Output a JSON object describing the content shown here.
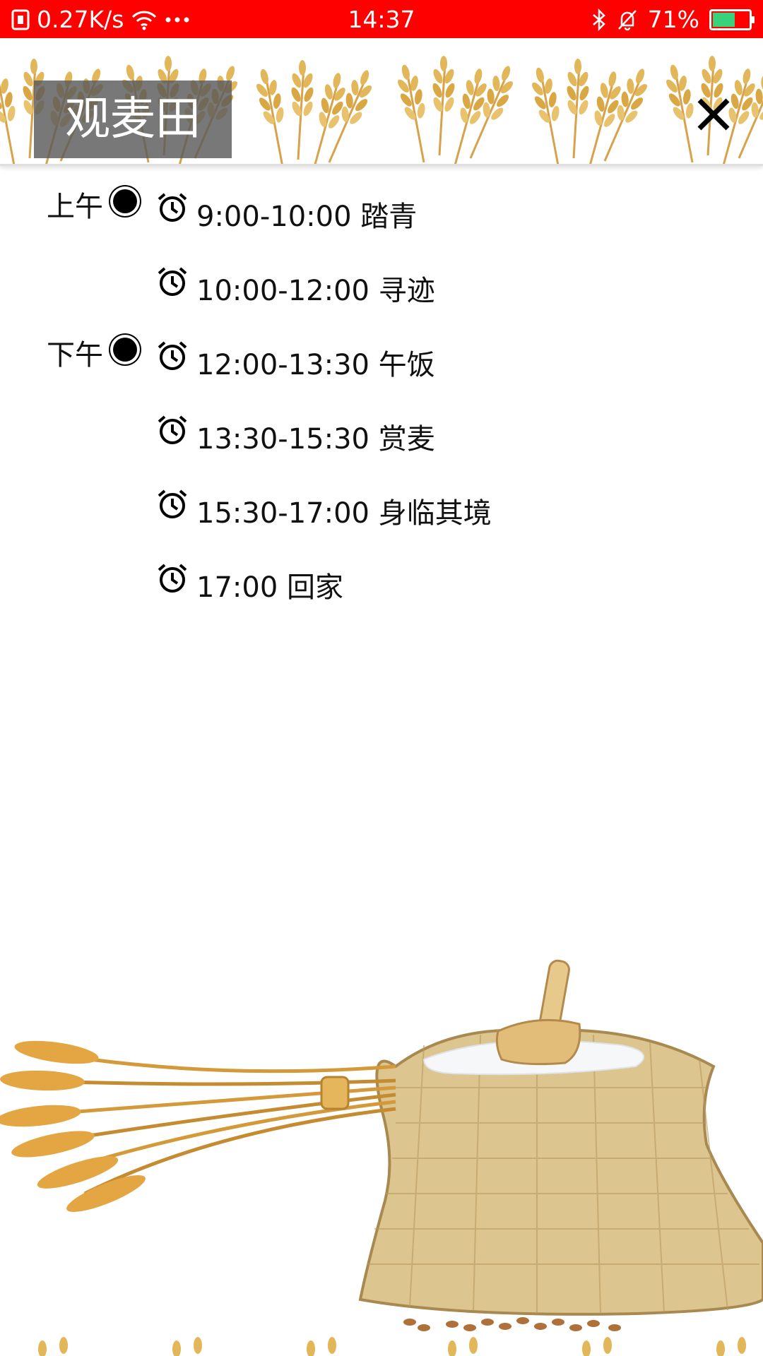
{
  "status_bar": {
    "speed": "0.27K/s",
    "time": "14:37",
    "battery": "71%",
    "battery_level": 0.71,
    "icons": [
      "sim-icon",
      "wifi-icon",
      "more-dots-icon",
      "bluetooth-icon",
      "mute-bell-icon",
      "battery-icon"
    ]
  },
  "header": {
    "title": "观麦田"
  },
  "schedule": {
    "periods": [
      "上午",
      "下午"
    ],
    "items": [
      {
        "time": "9:00-10:00",
        "activity": "踏青"
      },
      {
        "time": "10:00-12:00",
        "activity": "寻迹"
      },
      {
        "time": "12:00-13:30",
        "activity": "午饭"
      },
      {
        "time": "13:30-15:30",
        "activity": "赏麦"
      },
      {
        "time": "15:30-17:00",
        "activity": "身临其境"
      },
      {
        "time": "17:00",
        "activity": "回家"
      }
    ]
  },
  "colors": {
    "status_bar": "#ff0000",
    "wheat": "#e0b04a",
    "sack": "#d8c08a",
    "title_bg": "#5a5a5a"
  }
}
